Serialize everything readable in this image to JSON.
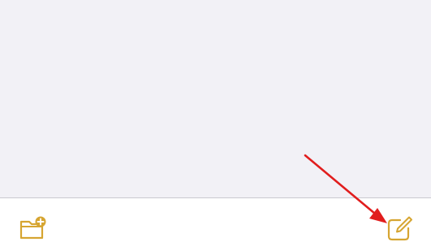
{
  "toolbar": {
    "left_icon": "new-folder-icon",
    "right_icon": "compose-icon",
    "accent_color": "#d6a531"
  },
  "annotation": {
    "arrow_color": "#e11d1d"
  },
  "background_color": "#f2f1f6"
}
